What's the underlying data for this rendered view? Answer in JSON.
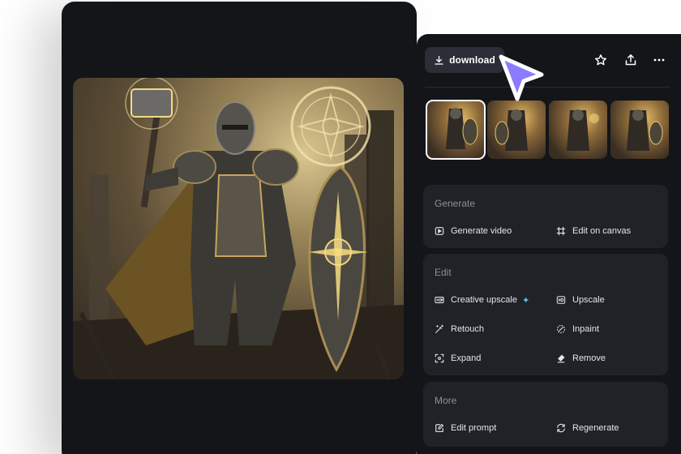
{
  "toolbar": {
    "download_label": "download",
    "icons": [
      "download-icon",
      "star-icon",
      "share-icon",
      "more-icon"
    ]
  },
  "thumbnails": [
    {
      "selected": true
    },
    {
      "selected": false
    },
    {
      "selected": false
    },
    {
      "selected": false
    }
  ],
  "generate": {
    "title": "Generate",
    "generate_video": "Generate video",
    "edit_on_canvas": "Edit on canvas"
  },
  "edit": {
    "title": "Edit",
    "creative_upscale": "Creative upscale",
    "upscale": "Upscale",
    "retouch": "Retouch",
    "inpaint": "Inpaint",
    "expand": "Expand",
    "remove": "Remove"
  },
  "more": {
    "title": "More",
    "edit_prompt": "Edit prompt",
    "regenerate": "Regenerate"
  },
  "colors": {
    "panel_bg": "#141519",
    "card_bg": "#202228",
    "cursor": "#8b7cff",
    "sparkle": "#3fd6f0"
  }
}
